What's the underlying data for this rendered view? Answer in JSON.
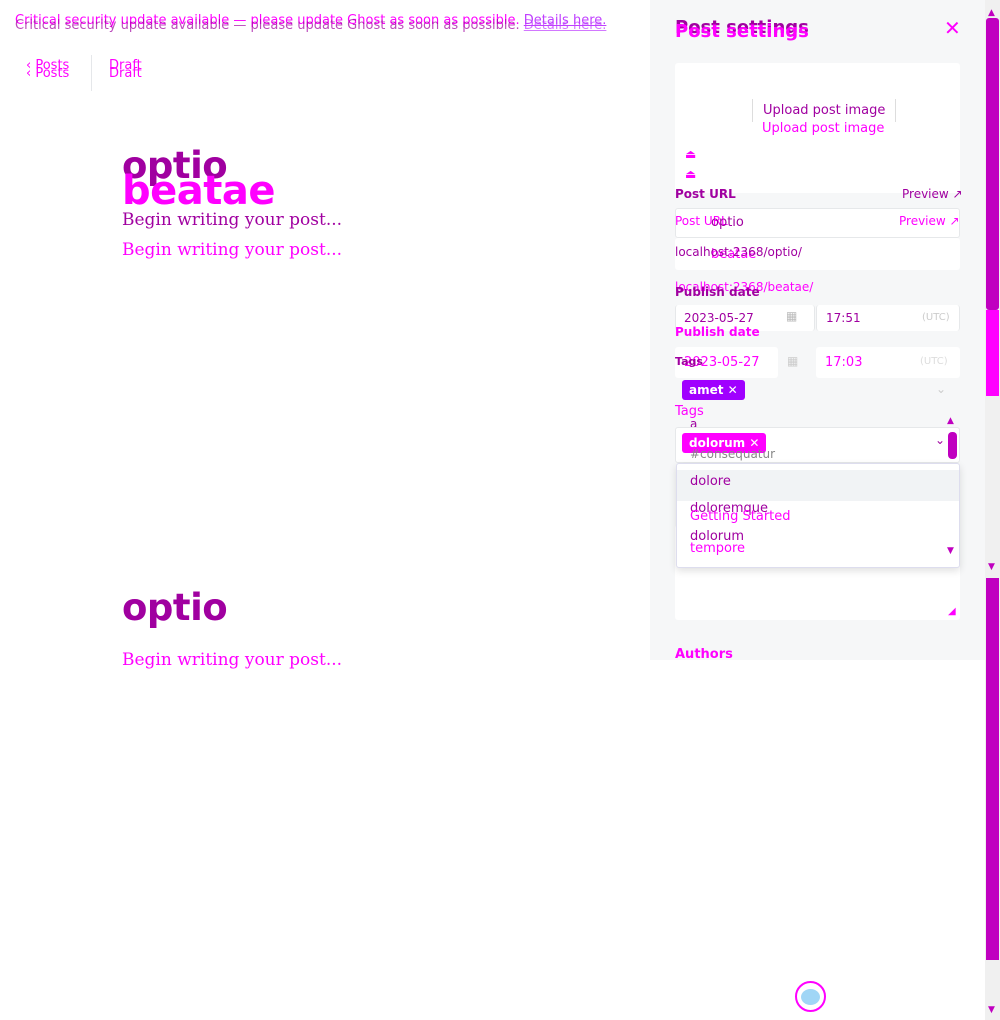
{
  "banner": {
    "text": "Critical security update available — please update Ghost as soon as possible.",
    "link": "Details here."
  },
  "nav": {
    "back_label": "Posts",
    "status": "Draft"
  },
  "editor": {
    "titles": [
      "optio",
      "beatae"
    ],
    "placeholder": "Begin writing your post..."
  },
  "settings": {
    "title": "Post settings",
    "upload_label": "Upload post image",
    "post_url_label": "Post URL",
    "preview_label": "Preview",
    "slugs": [
      "optio",
      "beatae"
    ],
    "urls": [
      "localhost:2368/optio/",
      "localhost:2368/beatae/"
    ],
    "publish_date_label": "Publish date",
    "dates": [
      {
        "date": "2023-05-27",
        "time": "17:51"
      },
      {
        "date": "2023-05-27",
        "time": "17:03"
      }
    ],
    "timezone": "(UTC)",
    "tags_label": "Tags",
    "tags": [
      "amet",
      "dolorum"
    ],
    "tag_input_value": "a",
    "tag_options": [
      "#consequatur",
      "dolore",
      "doloremque",
      "dolorum",
      "Getting Started",
      "tempore"
    ],
    "authors_label": "Authors"
  },
  "colors": {
    "accent": "#ff00ff",
    "accent_dark": "#a000a0",
    "chip1": "#a000ff"
  }
}
